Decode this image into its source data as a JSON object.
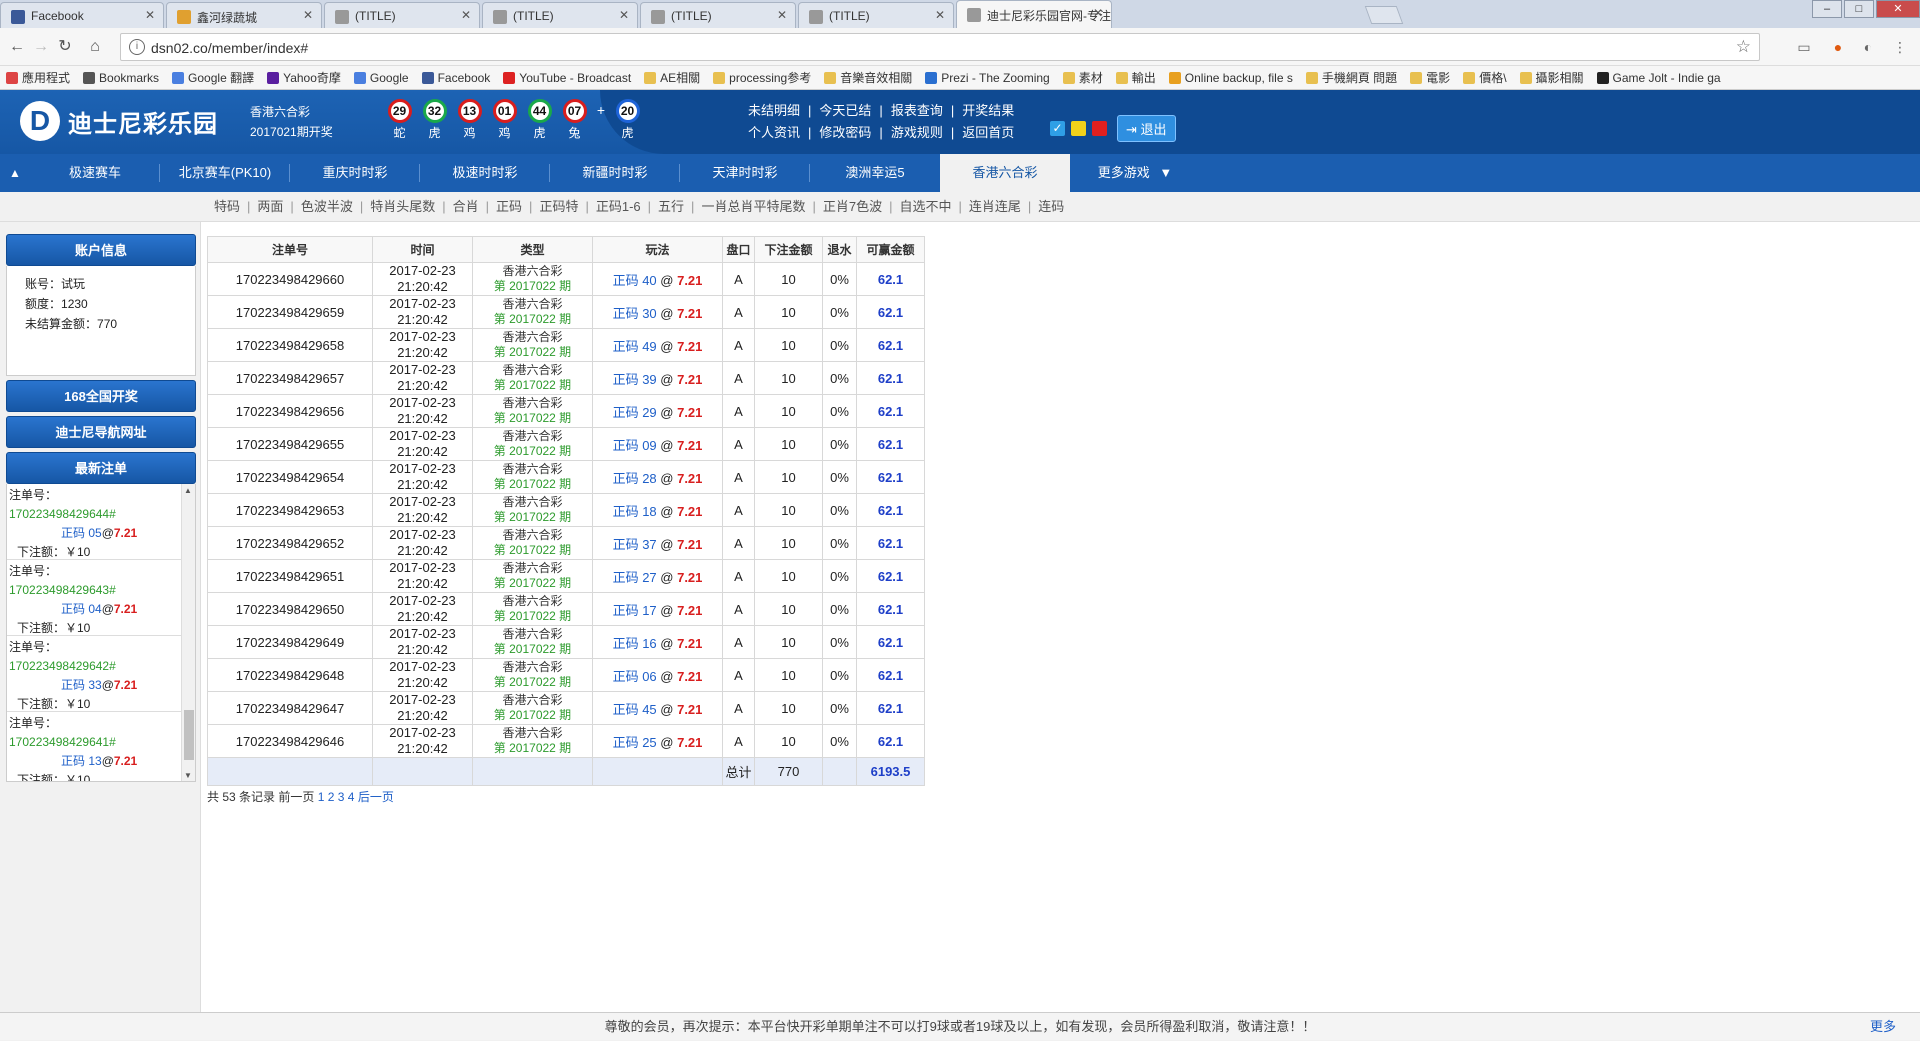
{
  "browser": {
    "tabs": [
      {
        "title": "Facebook",
        "color": "#3b5998"
      },
      {
        "title": "鑫河绿蔬城",
        "color": "#e0a030"
      },
      {
        "title": "(TITLE)",
        "color": "#999999"
      },
      {
        "title": "(TITLE)",
        "color": "#999999"
      },
      {
        "title": "(TITLE)",
        "color": "#999999"
      },
      {
        "title": "(TITLE)",
        "color": "#999999"
      },
      {
        "title": "迪士尼彩乐园官网-专注",
        "color": "#999999"
      }
    ],
    "url": "dsn02.co/member/index#",
    "bookmarks": [
      {
        "label": "應用程式",
        "color": "#d44"
      },
      {
        "label": "Bookmarks",
        "color": "#555"
      },
      {
        "label": "Google 翻譯",
        "color": "#4a7fe0"
      },
      {
        "label": "Yahoo奇摩",
        "color": "#5a1fa0"
      },
      {
        "label": "Google",
        "color": "#4a7fe0"
      },
      {
        "label": "Facebook",
        "color": "#3b5998"
      },
      {
        "label": "YouTube - Broadcast",
        "color": "#d22"
      },
      {
        "label": "AE相關",
        "color": "#e8c050"
      },
      {
        "label": "processing参考",
        "color": "#e8c050"
      },
      {
        "label": "音樂音效相關",
        "color": "#e8c050"
      },
      {
        "label": "Prezi - The Zooming",
        "color": "#2a6fd0"
      },
      {
        "label": "素材",
        "color": "#e8c050"
      },
      {
        "label": "輸出",
        "color": "#e8c050"
      },
      {
        "label": "Online backup, file s",
        "color": "#e8a020"
      },
      {
        "label": "手機網頁 問題",
        "color": "#e8c050"
      },
      {
        "label": "電影",
        "color": "#e8c050"
      },
      {
        "label": "價格\\",
        "color": "#e8c050"
      },
      {
        "label": "攝影相關",
        "color": "#e8c050"
      },
      {
        "label": "Game Jolt - Indie ga",
        "color": "#222"
      }
    ]
  },
  "site": {
    "logo_letter": "D",
    "logo_text": "迪士尼彩乐园",
    "lottery_name": "香港六合彩",
    "draw_period": "2017021期开奖",
    "balls": [
      {
        "num": "29",
        "zodiac": "蛇",
        "color": "#d81e1e"
      },
      {
        "num": "32",
        "zodiac": "虎",
        "color": "#1aa84a"
      },
      {
        "num": "13",
        "zodiac": "鸡",
        "color": "#d81e1e"
      },
      {
        "num": "01",
        "zodiac": "鸡",
        "color": "#d81e1e"
      },
      {
        "num": "44",
        "zodiac": "虎",
        "color": "#1aa84a"
      },
      {
        "num": "07",
        "zodiac": "兔",
        "color": "#d81e1e"
      }
    ],
    "plus": "+",
    "special_ball": {
      "num": "20",
      "zodiac": "虎",
      "color": "#1e63d8"
    },
    "links_row1": [
      "未结明细",
      "今天已结",
      "报表查询",
      "开奖结果"
    ],
    "links_row2": [
      "个人资讯",
      "修改密码",
      "游戏规则",
      "返回首页"
    ],
    "logout": "退出"
  },
  "nav": {
    "home_arrow": "▲",
    "games": [
      "极速赛车",
      "北京赛车(PK10)",
      "重庆时时彩",
      "极速时时彩",
      "新疆时时彩",
      "天津时时彩",
      "澳洲幸运5",
      "香港六合彩",
      "更多游戏"
    ],
    "more_arrow": "▼",
    "subnav": [
      "特码",
      "两面",
      "色波半波",
      "特肖头尾数",
      "合肖",
      "正码",
      "正码特",
      "正码1-6",
      "五行",
      "一肖总肖平特尾数",
      "正肖7色波",
      "自选不中",
      "连肖连尾",
      "连码"
    ]
  },
  "sidebar": {
    "account_title": "账户信息",
    "account_label": "账号：",
    "account_value": "试玩",
    "credit_label": "额度：",
    "credit_value": "1230",
    "unsettled_label": "未结算金额：",
    "unsettled_value": "770",
    "btn_168": "168全国开奖",
    "btn_nav": "迪士尼导航网址",
    "recent_title": "最新注单",
    "recent": [
      {
        "label": "注单号：",
        "id": "170223498429644#",
        "name": "正码 05",
        "odds": "7.21",
        "amount": "下注额：￥10"
      },
      {
        "label": "注单号：",
        "id": "170223498429643#",
        "name": "正码 04",
        "odds": "7.21",
        "amount": "下注额：￥10"
      },
      {
        "label": "注单号：",
        "id": "170223498429642#",
        "name": "正码 33",
        "odds": "7.21",
        "amount": "下注额：￥10"
      },
      {
        "label": "注单号：",
        "id": "170223498429641#",
        "name": "正码 13",
        "odds": "7.21",
        "amount": "下注额：￥10"
      }
    ]
  },
  "table": {
    "headers": [
      "注单号",
      "时间",
      "类型",
      "玩法",
      "盘口",
      "下注金额",
      "退水",
      "可赢金额"
    ],
    "rows": [
      {
        "id": "170223498429660",
        "date": "2017-02-23",
        "time": "21:20:42",
        "type": "香港六合彩",
        "period": "第 2017022 期",
        "play": "正码 40",
        "odds": "7.21",
        "handicap": "A",
        "amount": "10",
        "rebate": "0%",
        "win": "62.1"
      },
      {
        "id": "170223498429659",
        "date": "2017-02-23",
        "time": "21:20:42",
        "type": "香港六合彩",
        "period": "第 2017022 期",
        "play": "正码 30",
        "odds": "7.21",
        "handicap": "A",
        "amount": "10",
        "rebate": "0%",
        "win": "62.1"
      },
      {
        "id": "170223498429658",
        "date": "2017-02-23",
        "time": "21:20:42",
        "type": "香港六合彩",
        "period": "第 2017022 期",
        "play": "正码 49",
        "odds": "7.21",
        "handicap": "A",
        "amount": "10",
        "rebate": "0%",
        "win": "62.1"
      },
      {
        "id": "170223498429657",
        "date": "2017-02-23",
        "time": "21:20:42",
        "type": "香港六合彩",
        "period": "第 2017022 期",
        "play": "正码 39",
        "odds": "7.21",
        "handicap": "A",
        "amount": "10",
        "rebate": "0%",
        "win": "62.1"
      },
      {
        "id": "170223498429656",
        "date": "2017-02-23",
        "time": "21:20:42",
        "type": "香港六合彩",
        "period": "第 2017022 期",
        "play": "正码 29",
        "odds": "7.21",
        "handicap": "A",
        "amount": "10",
        "rebate": "0%",
        "win": "62.1"
      },
      {
        "id": "170223498429655",
        "date": "2017-02-23",
        "time": "21:20:42",
        "type": "香港六合彩",
        "period": "第 2017022 期",
        "play": "正码 09",
        "odds": "7.21",
        "handicap": "A",
        "amount": "10",
        "rebate": "0%",
        "win": "62.1"
      },
      {
        "id": "170223498429654",
        "date": "2017-02-23",
        "time": "21:20:42",
        "type": "香港六合彩",
        "period": "第 2017022 期",
        "play": "正码 28",
        "odds": "7.21",
        "handicap": "A",
        "amount": "10",
        "rebate": "0%",
        "win": "62.1"
      },
      {
        "id": "170223498429653",
        "date": "2017-02-23",
        "time": "21:20:42",
        "type": "香港六合彩",
        "period": "第 2017022 期",
        "play": "正码 18",
        "odds": "7.21",
        "handicap": "A",
        "amount": "10",
        "rebate": "0%",
        "win": "62.1"
      },
      {
        "id": "170223498429652",
        "date": "2017-02-23",
        "time": "21:20:42",
        "type": "香港六合彩",
        "period": "第 2017022 期",
        "play": "正码 37",
        "odds": "7.21",
        "handicap": "A",
        "amount": "10",
        "rebate": "0%",
        "win": "62.1"
      },
      {
        "id": "170223498429651",
        "date": "2017-02-23",
        "time": "21:20:42",
        "type": "香港六合彩",
        "period": "第 2017022 期",
        "play": "正码 27",
        "odds": "7.21",
        "handicap": "A",
        "amount": "10",
        "rebate": "0%",
        "win": "62.1"
      },
      {
        "id": "170223498429650",
        "date": "2017-02-23",
        "time": "21:20:42",
        "type": "香港六合彩",
        "period": "第 2017022 期",
        "play": "正码 17",
        "odds": "7.21",
        "handicap": "A",
        "amount": "10",
        "rebate": "0%",
        "win": "62.1"
      },
      {
        "id": "170223498429649",
        "date": "2017-02-23",
        "time": "21:20:42",
        "type": "香港六合彩",
        "period": "第 2017022 期",
        "play": "正码 16",
        "odds": "7.21",
        "handicap": "A",
        "amount": "10",
        "rebate": "0%",
        "win": "62.1"
      },
      {
        "id": "170223498429648",
        "date": "2017-02-23",
        "time": "21:20:42",
        "type": "香港六合彩",
        "period": "第 2017022 期",
        "play": "正码 06",
        "odds": "7.21",
        "handicap": "A",
        "amount": "10",
        "rebate": "0%",
        "win": "62.1"
      },
      {
        "id": "170223498429647",
        "date": "2017-02-23",
        "time": "21:20:42",
        "type": "香港六合彩",
        "period": "第 2017022 期",
        "play": "正码 45",
        "odds": "7.21",
        "handicap": "A",
        "amount": "10",
        "rebate": "0%",
        "win": "62.1"
      },
      {
        "id": "170223498429646",
        "date": "2017-02-23",
        "time": "21:20:42",
        "type": "香港六合彩",
        "period": "第 2017022 期",
        "play": "正码 25",
        "odds": "7.21",
        "handicap": "A",
        "amount": "10",
        "rebate": "0%",
        "win": "62.1"
      }
    ],
    "total_label": "总计",
    "total_amount": "770",
    "total_win": "6193.5"
  },
  "pager": {
    "summary": "共 53 条记录 前一页",
    "pages": [
      "1",
      "2",
      "3",
      "4"
    ],
    "next": "后一页"
  },
  "footer": {
    "notice": "尊敬的会员，再次提示：本平台快开彩单期单注不可以打9球或者19球及以上，如有发现，会员所得盈利取消，敬请注意！！",
    "more": "更多"
  }
}
